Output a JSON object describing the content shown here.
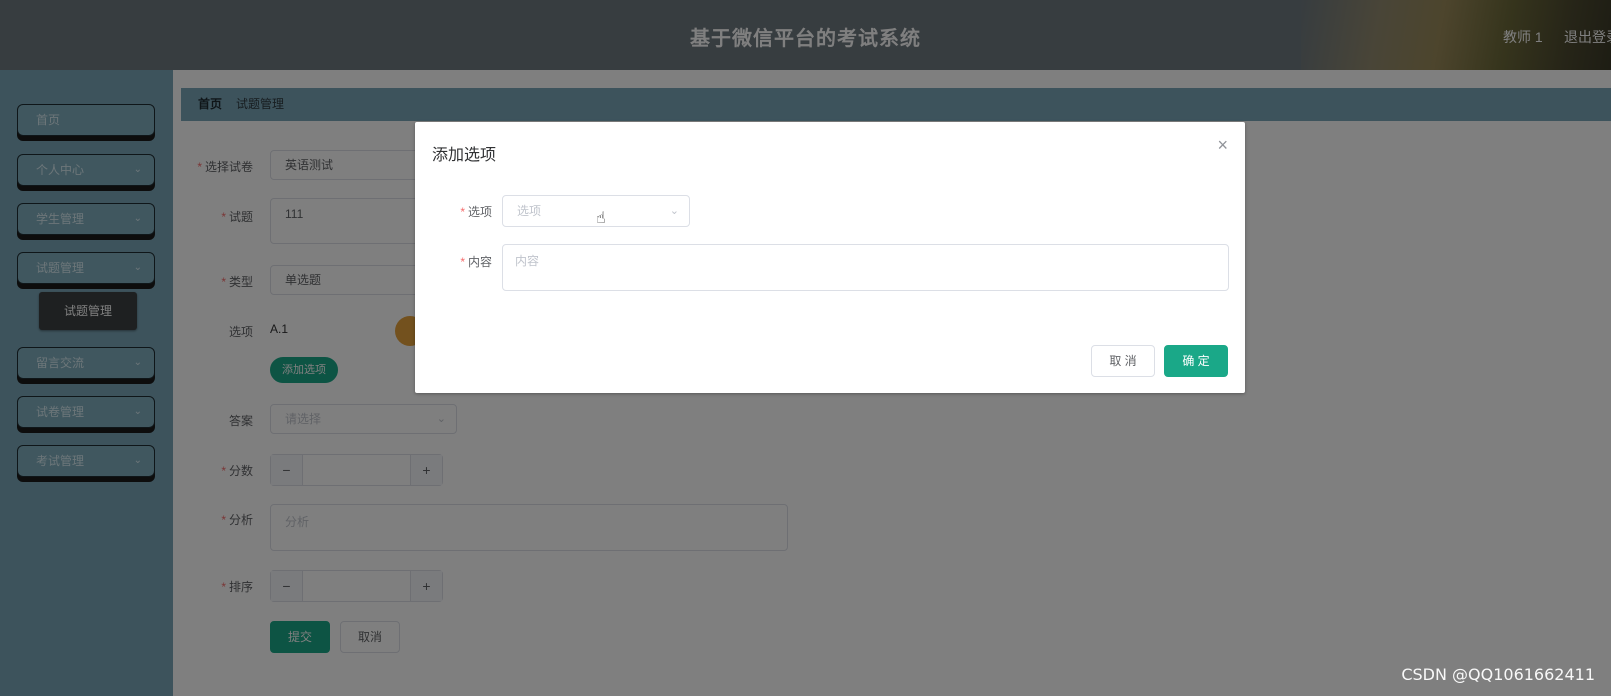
{
  "header": {
    "title": "基于微信平台的考试系统",
    "user": "教师 1",
    "logout": "退出登录"
  },
  "sidebar": {
    "items": [
      {
        "label": "首页",
        "has_arrow": false
      },
      {
        "label": "个人中心",
        "has_arrow": true
      },
      {
        "label": "学生管理",
        "has_arrow": true
      },
      {
        "label": "试题管理",
        "has_arrow": true
      },
      {
        "label": "留言交流",
        "has_arrow": true
      },
      {
        "label": "试卷管理",
        "has_arrow": true
      },
      {
        "label": "考试管理",
        "has_arrow": true
      }
    ],
    "submenu": {
      "label": "试题管理"
    },
    "arrow_icon": "chevron-down-icon"
  },
  "breadcrumb": {
    "home": "首页",
    "current": "试题管理"
  },
  "form": {
    "paper_label": "选择试卷",
    "paper_value": "英语测试",
    "question_label": "试题",
    "question_value": "111",
    "type_label": "类型",
    "type_value": "单选题",
    "options_label": "选项",
    "option_value": "A.1",
    "add_option_label": "添加选项",
    "answer_label": "答案",
    "answer_placeholder": "请选择",
    "score_label": "分数",
    "analysis_label": "分析",
    "analysis_placeholder": "分析",
    "sort_label": "排序",
    "submit_label": "提交",
    "cancel_label": "取消",
    "minus": "−",
    "plus": "+"
  },
  "dialog": {
    "title": "添加选项",
    "close": "×",
    "option_label": "选项",
    "option_placeholder": "选项",
    "content_label": "内容",
    "content_placeholder": "内容",
    "cancel_label": "取 消",
    "confirm_label": "确 定"
  },
  "watermark": "CSDN @QQ1061662411",
  "colors": {
    "primary": "#1aa888",
    "sidebar": "#7ba6b8",
    "required": "#f56c6c"
  }
}
